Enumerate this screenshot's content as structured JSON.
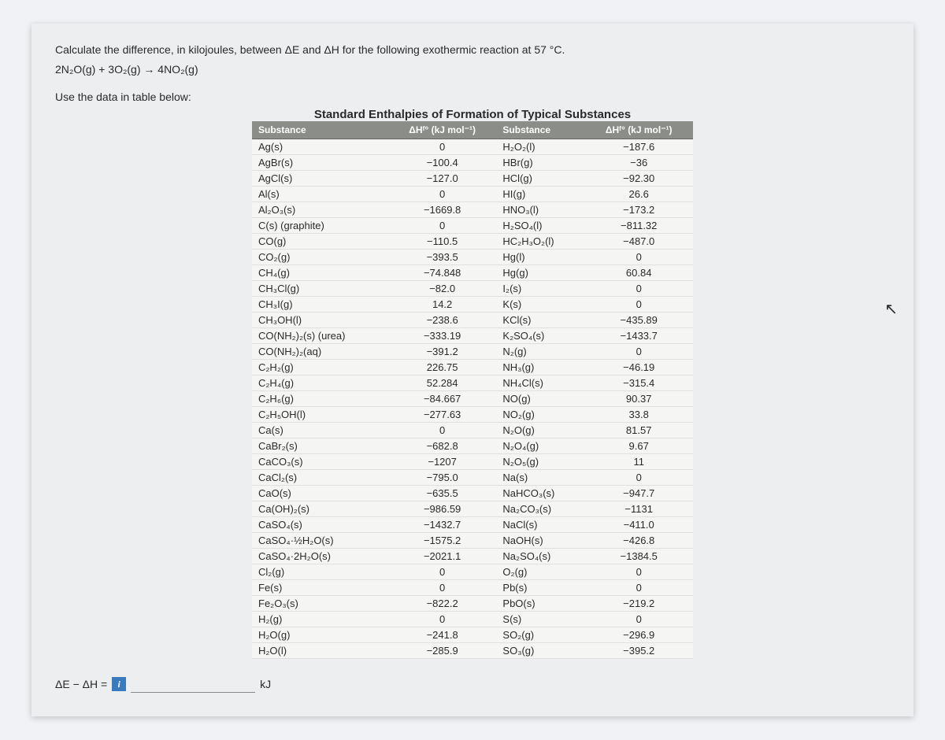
{
  "prompt": "Calculate the difference, in kilojoules, between ΔE and ΔH for the following exothermic reaction at 57 °C.",
  "reaction": "2N₂O(g) + 3O₂(g) → 4NO₂(g)",
  "lead_in": "Use the data in table below:",
  "table_caption": "Standard Enthalpies of Formation of Typical Substances",
  "header": {
    "h1": "Substance",
    "h2": "ΔHᶠ° (kJ mol⁻¹)",
    "h3": "Substance",
    "h4": "ΔHᶠ° (kJ mol⁻¹)"
  },
  "rows": [
    {
      "s1": "Ag(s)",
      "v1": "0",
      "s2": "H₂O₂(l)",
      "v2": "−187.6"
    },
    {
      "s1": "AgBr(s)",
      "v1": "−100.4",
      "s2": "HBr(g)",
      "v2": "−36"
    },
    {
      "s1": "AgCl(s)",
      "v1": "−127.0",
      "s2": "HCl(g)",
      "v2": "−92.30"
    },
    {
      "s1": "Al(s)",
      "v1": "0",
      "s2": "HI(g)",
      "v2": "26.6"
    },
    {
      "s1": "Al₂O₃(s)",
      "v1": "−1669.8",
      "s2": "HNO₃(l)",
      "v2": "−173.2"
    },
    {
      "s1": "C(s) (graphite)",
      "v1": "0",
      "s2": "H₂SO₄(l)",
      "v2": "−811.32"
    },
    {
      "s1": "CO(g)",
      "v1": "−110.5",
      "s2": "HC₂H₃O₂(l)",
      "v2": "−487.0"
    },
    {
      "s1": "CO₂(g)",
      "v1": "−393.5",
      "s2": "Hg(l)",
      "v2": "0"
    },
    {
      "s1": "CH₄(g)",
      "v1": "−74.848",
      "s2": "Hg(g)",
      "v2": "60.84"
    },
    {
      "s1": "CH₃Cl(g)",
      "v1": "−82.0",
      "s2": "I₂(s)",
      "v2": "0"
    },
    {
      "s1": "CH₃I(g)",
      "v1": "14.2",
      "s2": "K(s)",
      "v2": "0"
    },
    {
      "s1": "CH₃OH(l)",
      "v1": "−238.6",
      "s2": "KCl(s)",
      "v2": "−435.89"
    },
    {
      "s1": "CO(NH₂)₂(s) (urea)",
      "v1": "−333.19",
      "s2": "K₂SO₄(s)",
      "v2": "−1433.7"
    },
    {
      "s1": "CO(NH₂)₂(aq)",
      "v1": "−391.2",
      "s2": "N₂(g)",
      "v2": "0"
    },
    {
      "s1": "C₂H₂(g)",
      "v1": "226.75",
      "s2": "NH₃(g)",
      "v2": "−46.19"
    },
    {
      "s1": "C₂H₄(g)",
      "v1": "52.284",
      "s2": "NH₄Cl(s)",
      "v2": "−315.4"
    },
    {
      "s1": "C₂H₆(g)",
      "v1": "−84.667",
      "s2": "NO(g)",
      "v2": "90.37"
    },
    {
      "s1": "C₂H₅OH(l)",
      "v1": "−277.63",
      "s2": "NO₂(g)",
      "v2": "33.8"
    },
    {
      "s1": "Ca(s)",
      "v1": "0",
      "s2": "N₂O(g)",
      "v2": "81.57"
    },
    {
      "s1": "CaBr₂(s)",
      "v1": "−682.8",
      "s2": "N₂O₄(g)",
      "v2": "9.67"
    },
    {
      "s1": "CaCO₃(s)",
      "v1": "−1207",
      "s2": "N₂O₅(g)",
      "v2": "11"
    },
    {
      "s1": "CaCl₂(s)",
      "v1": "−795.0",
      "s2": "Na(s)",
      "v2": "0"
    },
    {
      "s1": "CaO(s)",
      "v1": "−635.5",
      "s2": "NaHCO₃(s)",
      "v2": "−947.7"
    },
    {
      "s1": "Ca(OH)₂(s)",
      "v1": "−986.59",
      "s2": "Na₂CO₃(s)",
      "v2": "−1131"
    },
    {
      "s1": "CaSO₄(s)",
      "v1": "−1432.7",
      "s2": "NaCl(s)",
      "v2": "−411.0"
    },
    {
      "s1": "CaSO₄·½H₂O(s)",
      "v1": "−1575.2",
      "s2": "NaOH(s)",
      "v2": "−426.8"
    },
    {
      "s1": "CaSO₄·2H₂O(s)",
      "v1": "−2021.1",
      "s2": "Na₂SO₄(s)",
      "v2": "−1384.5"
    },
    {
      "s1": "Cl₂(g)",
      "v1": "0",
      "s2": "O₂(g)",
      "v2": "0"
    },
    {
      "s1": "Fe(s)",
      "v1": "0",
      "s2": "Pb(s)",
      "v2": "0"
    },
    {
      "s1": "Fe₂O₃(s)",
      "v1": "−822.2",
      "s2": "PbO(s)",
      "v2": "−219.2"
    },
    {
      "s1": "H₂(g)",
      "v1": "0",
      "s2": "S(s)",
      "v2": "0"
    },
    {
      "s1": "H₂O(g)",
      "v1": "−241.8",
      "s2": "SO₂(g)",
      "v2": "−296.9"
    },
    {
      "s1": "H₂O(l)",
      "v1": "−285.9",
      "s2": "SO₃(g)",
      "v2": "−395.2"
    }
  ],
  "answer": {
    "label": "ΔE − ΔH =",
    "info": "i",
    "unit": "kJ"
  }
}
